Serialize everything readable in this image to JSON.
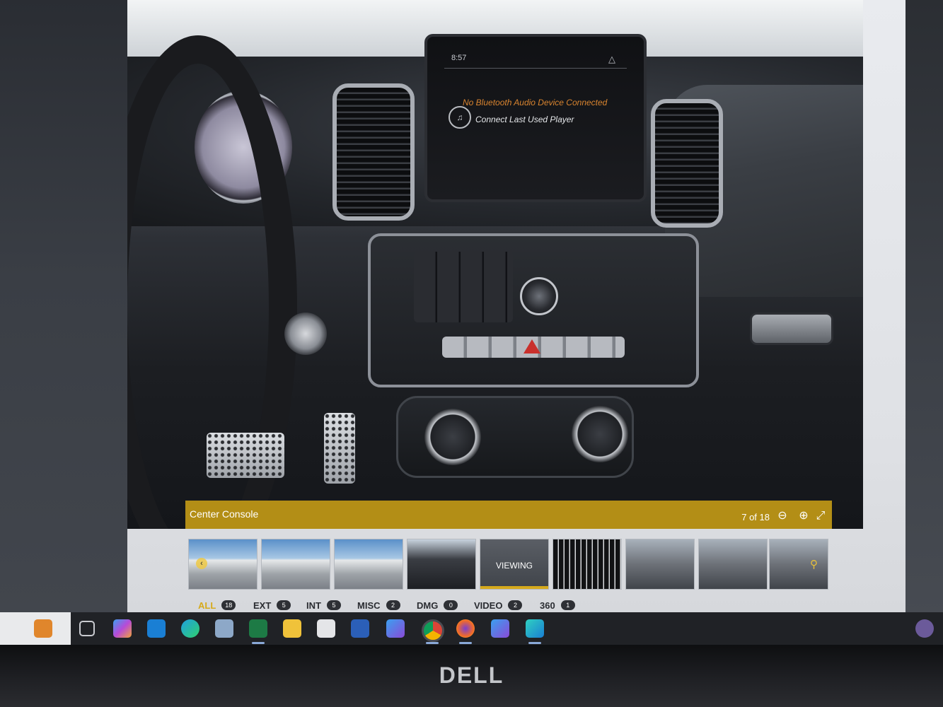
{
  "photo": {
    "alt": "Center Console",
    "infotainment": {
      "time": "8:57",
      "message": "No Bluetooth Audio Device Connected",
      "action": "Connect Last Used Player",
      "icon": "media-icon",
      "status_icon": "navigation-icon"
    }
  },
  "viewer": {
    "caption": "Center Console",
    "counter": "7 of 18",
    "tools": {
      "zoom_out_icon": "zoom-out-icon",
      "zoom_in_icon": "zoom-in-icon",
      "collapse_icon": "collapse-icon"
    },
    "accent_color": "#b38e16"
  },
  "thumbnails": [
    {
      "kind": "exterior",
      "has_prev_arrow": true
    },
    {
      "kind": "exterior"
    },
    {
      "kind": "exterior"
    },
    {
      "kind": "interior"
    },
    {
      "kind": "current",
      "label": "VIEWING"
    },
    {
      "kind": "interior"
    },
    {
      "kind": "interior"
    },
    {
      "kind": "interior"
    },
    {
      "kind": "interior",
      "has_search_icon": true
    }
  ],
  "filters": [
    {
      "label": "ALL",
      "count": "18",
      "active": true
    },
    {
      "label": "EXT",
      "count": "5"
    },
    {
      "label": "INT",
      "count": "5"
    },
    {
      "label": "MISC",
      "count": "2"
    },
    {
      "label": "DMG",
      "count": "0"
    },
    {
      "label": "VIDEO",
      "count": "2"
    },
    {
      "label": "360",
      "count": "1"
    }
  ],
  "taskbar": {
    "apps": [
      "work-icon",
      "task-view-icon",
      "copilot-icon",
      "mail-icon",
      "edge-icon",
      "remote-desktop-icon",
      "excel-icon",
      "file-explorer-icon",
      "paint-icon",
      "word-icon",
      "copilot-app-icon",
      "chrome-icon",
      "firefox-icon",
      "copilot-alt-icon",
      "app-icon"
    ]
  },
  "monitor": {
    "brand": "DELL"
  }
}
